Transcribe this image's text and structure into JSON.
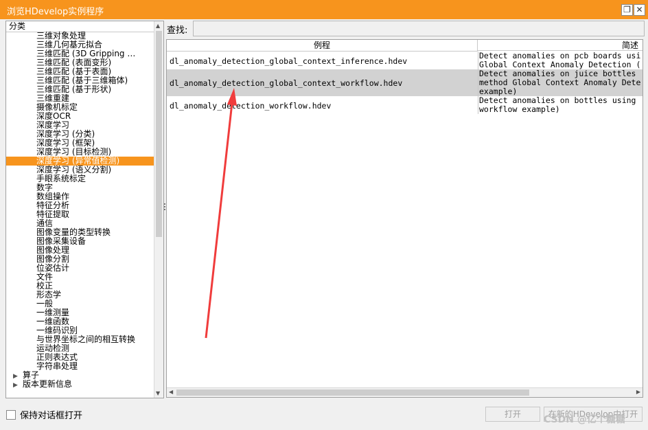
{
  "window": {
    "title": "浏览HDevelop实例程序",
    "restore_icon": "restore-icon",
    "close_icon": "close-icon"
  },
  "tree": {
    "header": "分类",
    "items": [
      "三维对象处理",
      "三维几何基元拟合",
      "三维匹配 (3D Gripping …",
      "三维匹配 (表面变形)",
      "三维匹配 (基于表面)",
      "三维匹配 (基于三维箱体)",
      "三维匹配 (基于形状)",
      "三维重建",
      "摄像机标定",
      "深度OCR",
      "深度学习",
      "深度学习 (分类)",
      "深度学习 (框架)",
      "深度学习 (目标检测)",
      "深度学习 (异常值检测)",
      "深度学习 (语义分割)",
      "手眼系统标定",
      "数字",
      "数组操作",
      "特征分析",
      "特征提取",
      "通信",
      "图像变量的类型转换",
      "图像采集设备",
      "图像处理",
      "图像分割",
      "位姿估计",
      "文件",
      "校正",
      "形态学",
      "一般",
      "一维测量",
      "一维函数",
      "一维码识别",
      "与世界坐标之间的相互转换",
      "运动检测",
      "正则表达式",
      "字符串处理"
    ],
    "selected_index": 14,
    "roots": [
      "算子",
      "版本更新信息"
    ]
  },
  "search": {
    "label": "查找:",
    "value": ""
  },
  "table": {
    "columns": [
      "例程",
      "简述"
    ],
    "rows": [
      {
        "name": "dl_anomaly_detection_global_context_inference.hdev",
        "desc": [
          "Detect anomalies on pcb boards usi",
          "Global Context Anomaly Detection ("
        ]
      },
      {
        "name": "dl_anomaly_detection_global_context_workflow.hdev",
        "desc": [
          "Detect anomalies on juice bottles",
          "method Global Context Anomaly Dete",
          "example)"
        ]
      },
      {
        "name": "dl_anomaly_detection_workflow.hdev",
        "desc": [
          "Detect anomalies on bottles using",
          "workflow example)"
        ]
      }
    ],
    "selected_row": 1
  },
  "footer": {
    "keep_open": "保持对话框打开",
    "open_button": "打开",
    "open_new_button": "在新的HDevelop中打开"
  },
  "watermark": "CSDN @亿个糖糖",
  "colors": {
    "accent": "#f7941d",
    "selected_row": "#d2d2d2",
    "annotation_arrow": "#f03c3c"
  }
}
